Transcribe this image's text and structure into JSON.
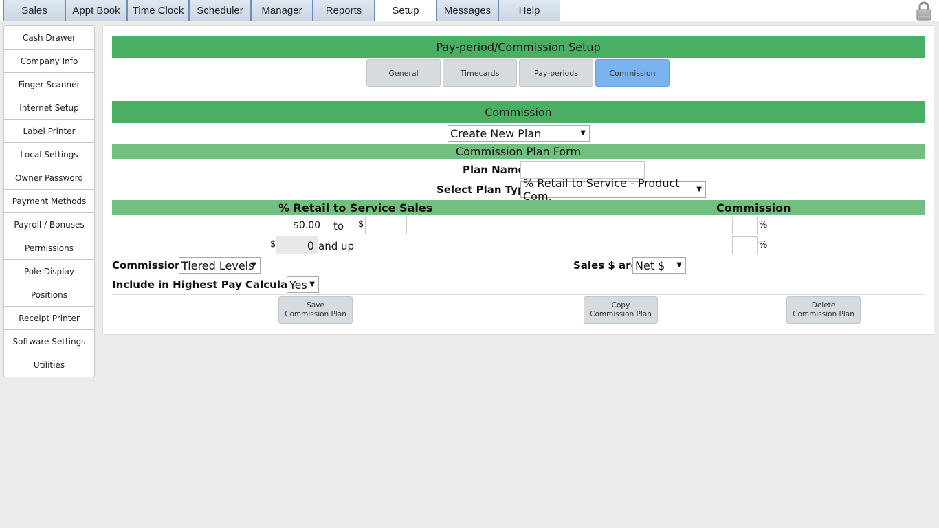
{
  "top_tabs": [
    "Sales",
    "Appt Book",
    "Time Clock",
    "Scheduler",
    "Manager",
    "Reports",
    "Setup",
    "Messages",
    "Help"
  ],
  "active_top_tab": "Setup",
  "sidebar": {
    "items": [
      "Cash Drawer",
      "Company Info",
      "Finger Scanner",
      "Internet Setup",
      "Label Printer",
      "Local Settings",
      "Owner Password",
      "Payment Methods",
      "Payroll / Bonuses",
      "Permissions",
      "Pole Display",
      "Positions",
      "Receipt Printer",
      "Software Settings",
      "Utilities"
    ]
  },
  "main": {
    "title": "Pay-period/Commission Setup",
    "subtabs": [
      "General",
      "Timecards",
      "Pay-periods",
      "Commission"
    ],
    "active_subtab": "Commission",
    "section_title": "Commission",
    "plan_select": "Create New Plan",
    "form_title": "Commission Plan Form",
    "plan_name_label": "Plan Name:",
    "plan_name_value": "",
    "plan_type_label": "Select Plan Type:",
    "plan_type_value": "% Retail to Service - Product Com.",
    "table_header_left": "% Retail to Service Sales",
    "table_header_right": "Commission",
    "row1": {
      "from": "$0.00",
      "to_label": "to",
      "dollar": "$",
      "to_value": "",
      "percent_value": "",
      "percent_sign": "%"
    },
    "row2": {
      "dollar": "$",
      "from_value": "0",
      "and_up": "and up",
      "percent_value": "",
      "percent_sign": "%"
    },
    "commission_label": "Commission:",
    "commission_value": "Tiered Levels",
    "sales_label": "Sales $ are:",
    "sales_value": "Net $",
    "highest_pay_label": "Include in Highest Pay Calculation:",
    "highest_pay_value": "Yes",
    "buttons": {
      "save": "Save Commission Plan",
      "copy": "Copy Commission Plan",
      "delete": "Delete Commission Plan"
    }
  },
  "colors": {
    "header_green": "#4aaf63",
    "light_green": "#72c07f",
    "active_subtab": "#7bb3f0"
  }
}
